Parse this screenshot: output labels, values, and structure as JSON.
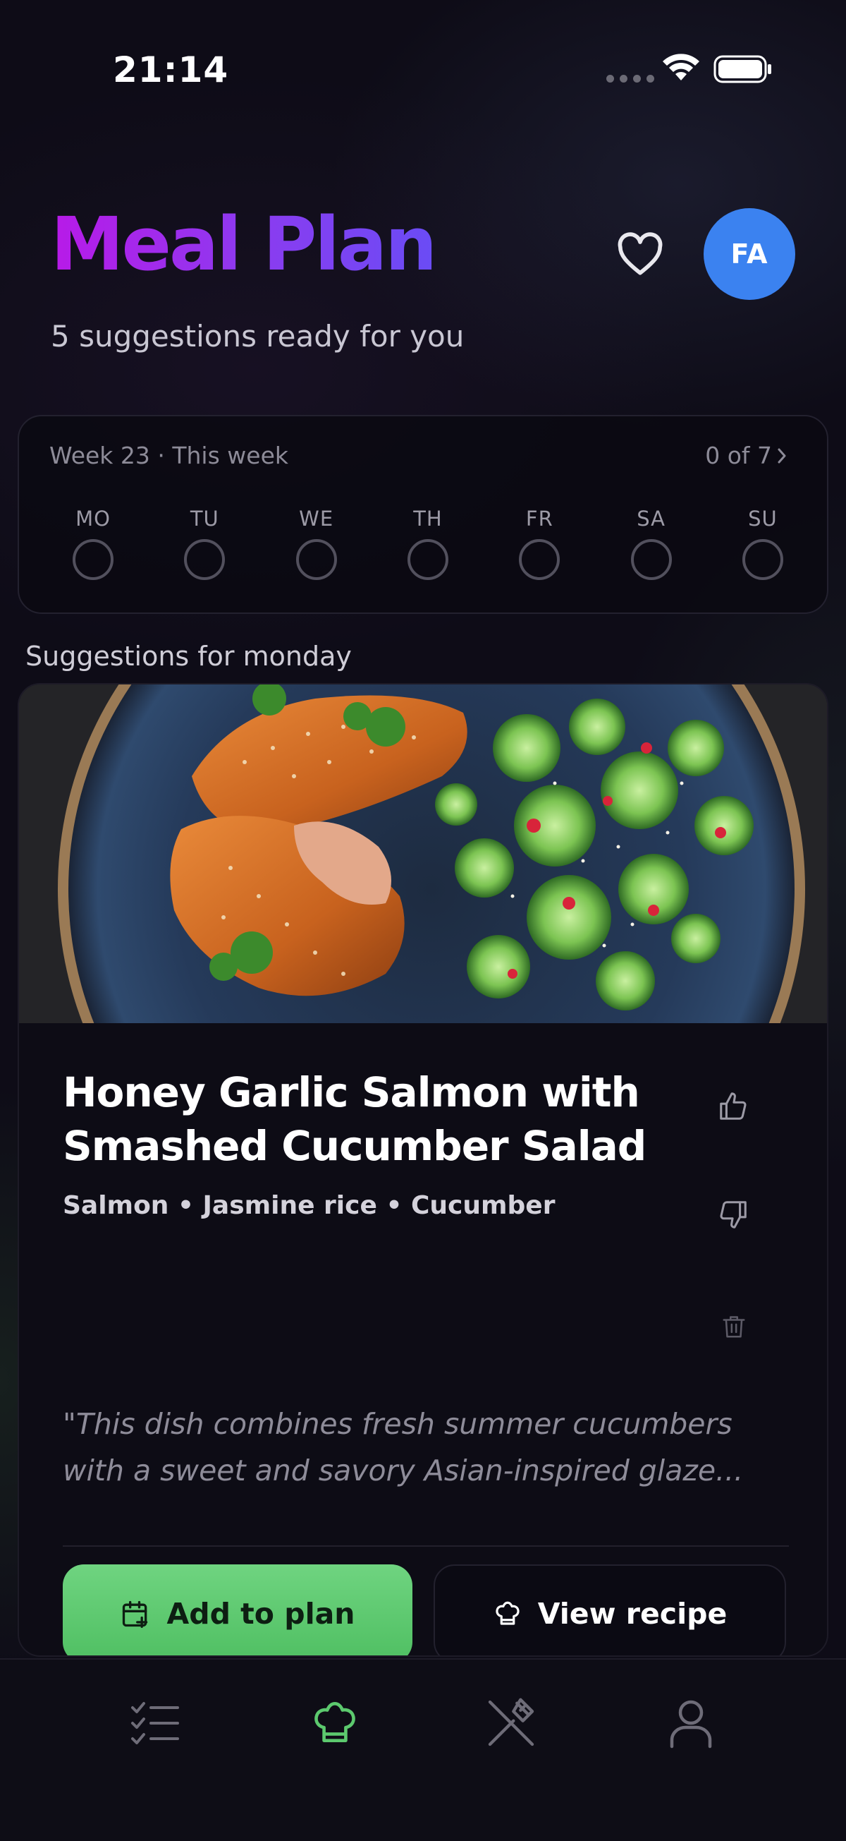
{
  "status_bar": {
    "time": "21:14"
  },
  "header": {
    "title": "Meal Plan",
    "subtitle": "5 suggestions ready for you",
    "avatar_initials": "FA"
  },
  "week": {
    "label": "Week 23 · This week",
    "progress": "0 of 7",
    "days": [
      "MO",
      "TU",
      "WE",
      "TH",
      "FR",
      "SA",
      "SU"
    ]
  },
  "section_label": "Suggestions for monday",
  "meal": {
    "title": "Honey Garlic Salmon with Smashed Cucumber Salad",
    "ingredients": "Salmon • Jasmine rice • Cucumber",
    "description": "\"This dish combines fresh summer cucumbers with a sweet and savory Asian-inspired glaze...",
    "add_label": "Add to plan",
    "recipe_label": "View recipe"
  },
  "colors": {
    "accent_green": "#5cc96e",
    "avatar_blue": "#3b82f0",
    "title_gradient_start": "#b81ae8",
    "title_gradient_end": "#6a4cf5"
  },
  "tab_bar": {
    "tabs": [
      {
        "icon": "checklist-icon",
        "active": false
      },
      {
        "icon": "chef-hat-icon",
        "active": true
      },
      {
        "icon": "utensils-crossed-icon",
        "active": false
      },
      {
        "icon": "user-icon",
        "active": false
      }
    ]
  }
}
